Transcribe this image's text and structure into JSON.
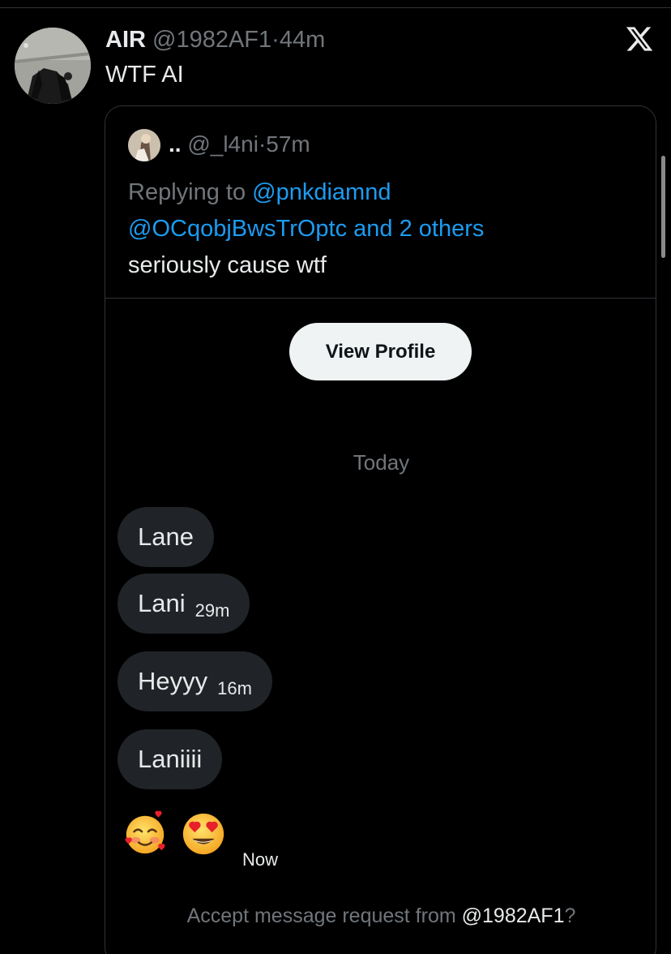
{
  "tweet": {
    "author_name": "AIR",
    "author_handle": "@1982AF1",
    "separator": "·",
    "time": "44m",
    "text": "WTF AI"
  },
  "quoted": {
    "author_name": "..",
    "author_handle": "@_l4ni",
    "separator": "·",
    "time": "57m",
    "replying_prefix": "Replying to",
    "mention_1": "@pnkdiamnd",
    "mention_2": "@OCqobjBwsTrOptc and 2 others",
    "text": "seriously cause wtf"
  },
  "dm": {
    "view_profile_label": "View Profile",
    "date_separator": "Today",
    "messages": [
      {
        "text": "Lane",
        "time": ""
      },
      {
        "text": "Lani",
        "time": "29m"
      },
      {
        "text": "Heyyy",
        "time": "16m"
      },
      {
        "text": "Laniiii",
        "time": ""
      }
    ],
    "reactions": [
      "smiling-face-with-hearts",
      "heart-eyes"
    ],
    "reactions_time": "Now",
    "accept_prefix": "Accept message request from",
    "accept_handle": "@1982AF1",
    "accept_suffix": "?"
  },
  "icons": {
    "brand": "x-logo-icon"
  },
  "colors": {
    "background": "#000000",
    "link": "#1d9bf0",
    "muted": "#71767b",
    "bubble": "#202327",
    "button": "#eff3f4"
  }
}
